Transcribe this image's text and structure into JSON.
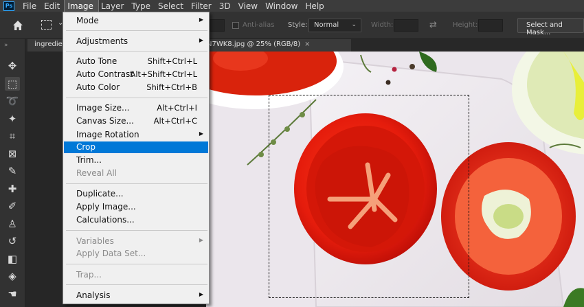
{
  "app": {
    "logo_text": "Ps"
  },
  "menubar": {
    "items": [
      {
        "label": "File",
        "active": false
      },
      {
        "label": "Edit",
        "active": false
      },
      {
        "label": "Image",
        "active": true
      },
      {
        "label": "Layer",
        "active": false
      },
      {
        "label": "Type",
        "active": false
      },
      {
        "label": "Select",
        "active": false
      },
      {
        "label": "Filter",
        "active": false
      },
      {
        "label": "3D",
        "active": false
      },
      {
        "label": "View",
        "active": false
      },
      {
        "label": "Window",
        "active": false
      },
      {
        "label": "Help",
        "active": false
      }
    ]
  },
  "options_bar": {
    "anti_alias_label": "Anti-alias",
    "style_label": "Style:",
    "style_value": "Normal",
    "width_label": "Width:",
    "height_label": "Height:",
    "select_mask_label": "Select and Mask..."
  },
  "tabs": [
    {
      "label": "ingredie"
    },
    {
      "label": "N7WK8.jpg @ 25% (RGB/8)",
      "close": "×"
    }
  ],
  "image_menu": {
    "items": [
      {
        "label": "Mode",
        "shortcut": "",
        "submenu": true,
        "disabled": false,
        "highlighted": false
      },
      {
        "sep": true
      },
      {
        "label": "Adjustments",
        "shortcut": "",
        "submenu": true,
        "disabled": false,
        "highlighted": false
      },
      {
        "sep": true
      },
      {
        "label": "Auto Tone",
        "shortcut": "Shift+Ctrl+L",
        "submenu": false,
        "disabled": false,
        "highlighted": false
      },
      {
        "label": "Auto Contrast",
        "shortcut": "Alt+Shift+Ctrl+L",
        "submenu": false,
        "disabled": false,
        "highlighted": false
      },
      {
        "label": "Auto Color",
        "shortcut": "Shift+Ctrl+B",
        "submenu": false,
        "disabled": false,
        "highlighted": false
      },
      {
        "sep": true
      },
      {
        "label": "Image Size...",
        "shortcut": "Alt+Ctrl+I",
        "submenu": false,
        "disabled": false,
        "highlighted": false
      },
      {
        "label": "Canvas Size...",
        "shortcut": "Alt+Ctrl+C",
        "submenu": false,
        "disabled": false,
        "highlighted": false
      },
      {
        "label": "Image Rotation",
        "shortcut": "",
        "submenu": true,
        "disabled": false,
        "highlighted": false
      },
      {
        "label": "Crop",
        "shortcut": "",
        "submenu": false,
        "disabled": false,
        "highlighted": true
      },
      {
        "label": "Trim...",
        "shortcut": "",
        "submenu": false,
        "disabled": false,
        "highlighted": false
      },
      {
        "label": "Reveal All",
        "shortcut": "",
        "submenu": false,
        "disabled": true,
        "highlighted": false
      },
      {
        "sep": true
      },
      {
        "label": "Duplicate...",
        "shortcut": "",
        "submenu": false,
        "disabled": false,
        "highlighted": false
      },
      {
        "label": "Apply Image...",
        "shortcut": "",
        "submenu": false,
        "disabled": false,
        "highlighted": false
      },
      {
        "label": "Calculations...",
        "shortcut": "",
        "submenu": false,
        "disabled": false,
        "highlighted": false
      },
      {
        "sep": true
      },
      {
        "label": "Variables",
        "shortcut": "",
        "submenu": true,
        "disabled": true,
        "highlighted": false
      },
      {
        "label": "Apply Data Set...",
        "shortcut": "",
        "submenu": false,
        "disabled": true,
        "highlighted": false
      },
      {
        "sep": true
      },
      {
        "label": "Trap...",
        "shortcut": "",
        "submenu": false,
        "disabled": true,
        "highlighted": false
      },
      {
        "sep": true
      },
      {
        "label": "Analysis",
        "shortcut": "",
        "submenu": true,
        "disabled": false,
        "highlighted": false
      }
    ]
  },
  "tools": [
    {
      "icon": "move-tool-icon",
      "glyph": "✥",
      "selected": false
    },
    {
      "icon": "rectangular-marquee-tool-icon",
      "glyph": "⬚",
      "selected": true
    },
    {
      "icon": "lasso-tool-icon",
      "glyph": "➰",
      "selected": false
    },
    {
      "icon": "magic-wand-tool-icon",
      "glyph": "✦",
      "selected": false
    },
    {
      "icon": "crop-tool-icon",
      "glyph": "⌗",
      "selected": false
    },
    {
      "icon": "frame-tool-icon",
      "glyph": "⊠",
      "selected": false
    },
    {
      "icon": "eyedropper-tool-icon",
      "glyph": "✎",
      "selected": false
    },
    {
      "icon": "healing-brush-tool-icon",
      "glyph": "✚",
      "selected": false
    },
    {
      "icon": "brush-tool-icon",
      "glyph": "✐",
      "selected": false
    },
    {
      "icon": "clone-stamp-tool-icon",
      "glyph": "♙",
      "selected": false
    },
    {
      "icon": "history-brush-tool-icon",
      "glyph": "↺",
      "selected": false
    },
    {
      "icon": "eraser-tool-icon",
      "glyph": "◧",
      "selected": false
    },
    {
      "icon": "paint-bucket-tool-icon",
      "glyph": "◈",
      "selected": false
    },
    {
      "icon": "smudge-tool-icon",
      "glyph": "☚",
      "selected": false
    }
  ]
}
